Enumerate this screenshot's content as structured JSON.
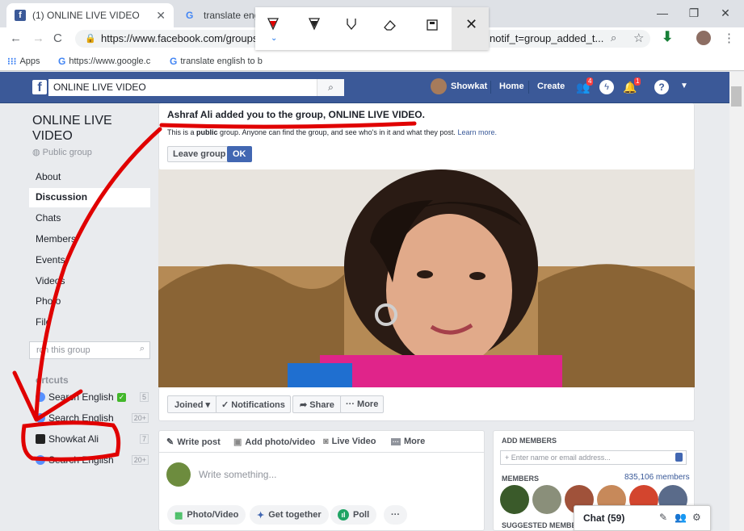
{
  "browser": {
    "tabs": [
      {
        "title": "(1) ONLINE LIVE VIDEO",
        "active": true
      },
      {
        "title": "translate engl",
        "active": false
      }
    ],
    "url_left": "https://www.facebook.com/groups",
    "url_right": "notif_t=group_added_t...",
    "bookmarks": [
      "Apps",
      "https://www.google.c",
      "translate english to b"
    ],
    "window_controls": [
      "minimize",
      "restore",
      "close"
    ]
  },
  "annotation_toolbar": {
    "tools": [
      "pen-red-icon",
      "pen-black-icon",
      "highlighter-icon",
      "eraser-icon",
      "save-icon",
      "close-icon"
    ]
  },
  "fb": {
    "logo": "f",
    "search_value": "ONLINE LIVE VIDEO",
    "user": "Showkat",
    "nav": [
      "Home",
      "Create"
    ],
    "badges": {
      "friends": "4",
      "notifications": "1"
    }
  },
  "left": {
    "group_name": "ONLINE LIVE VIDEO",
    "privacy": "Public group",
    "nav": [
      "About",
      "Discussion",
      "Chats",
      "Members",
      "Events",
      "Videos",
      "Photos",
      "Files"
    ],
    "nav_visible": [
      "About",
      "Discussion",
      "Chats",
      "Members",
      "Events",
      "Videos",
      "Photo",
      "File"
    ],
    "active_nav": "Discussion",
    "search_placeholder": "rch this group",
    "shortcuts_heading": "ortcuts",
    "shortcuts": [
      {
        "name": "Search English",
        "count": "5"
      },
      {
        "name": "Search English",
        "count": "20+"
      },
      {
        "name": "Showkat Ali",
        "count": "7"
      },
      {
        "name": "Search English",
        "count": "20+"
      }
    ]
  },
  "notice": {
    "text": "Ashraf Ali added you to the group, ONLINE LIVE VIDEO.",
    "sub_pre": "This is a ",
    "sub_bold": "public",
    "sub_post": " group. Anyone can find the group, and see who's in it and what they post.",
    "learn_more": "Learn more.",
    "leave_btn": "Leave group",
    "ok_btn": "OK"
  },
  "actions": {
    "joined": "Joined ▾",
    "notifications": "✓ Notifications",
    "share": "Share",
    "more": "··· More"
  },
  "composer": {
    "tabs": [
      "Write post",
      "Add photo/video",
      "Live Video",
      "More"
    ],
    "placeholder": "Write something...",
    "pills": [
      "Photo/Video",
      "Get together",
      "Poll",
      "···"
    ]
  },
  "sidebar_right": {
    "add_members_title": "ADD MEMBERS",
    "add_placeholder": "+ Enter name or email address...",
    "members_title": "MEMBERS",
    "members_count": "835,106 members",
    "suggested_title": "SUGGESTED MEMBE"
  },
  "chat": {
    "label": "Chat (59)"
  },
  "colors": {
    "fb_blue": "#3b5998",
    "annotation_red": "#e00000"
  }
}
